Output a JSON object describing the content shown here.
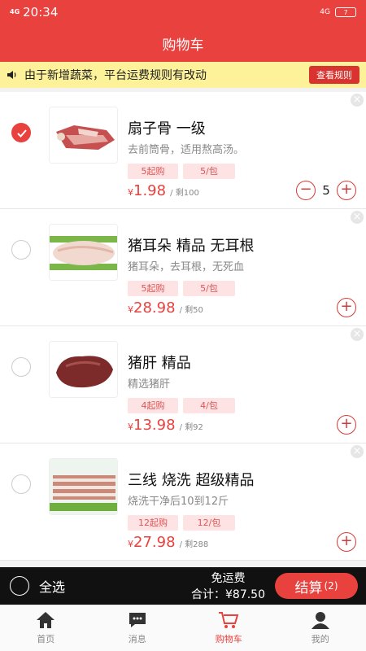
{
  "status_bar": {
    "time": "20:34",
    "signal": "4G",
    "network": "4G",
    "battery": "7"
  },
  "header": {
    "title": "购物车"
  },
  "notice": {
    "text": "由于新增蔬菜，平台运费规则有改动",
    "button": "查看规则"
  },
  "items": [
    {
      "name": "扇子骨 一级",
      "desc": "去前筒骨，适用熬高汤。",
      "min_order": "5起购",
      "pack": "5/包",
      "currency": "¥",
      "price": "1.98",
      "stock": "/ 剩100",
      "qty": "5",
      "checked": true,
      "image": "pork-bone-image"
    },
    {
      "name": "猪耳朵 精品 无耳根",
      "desc": "猪耳朵，去耳根，无死血",
      "min_order": "5起购",
      "pack": "5/包",
      "currency": "¥",
      "price": "28.98",
      "stock": "/ 剩50",
      "checked": false,
      "image": "pig-ear-image"
    },
    {
      "name": "猪肝 精品",
      "desc": "精选猪肝",
      "min_order": "4起购",
      "pack": "4/包",
      "currency": "¥",
      "price": "13.98",
      "stock": "/ 剩92",
      "checked": false,
      "image": "pork-liver-image"
    },
    {
      "name": "三线 烧洗 超级精品",
      "desc": "烧洗干净后10到12斤",
      "min_order": "12起购",
      "pack": "12/包",
      "currency": "¥",
      "price": "27.98",
      "stock": "/ 剩288",
      "checked": false,
      "image": "pork-belly-image"
    }
  ],
  "checkout": {
    "select_all": "全选",
    "free_shipping": "免运费",
    "total": "合计：¥87.50",
    "button": "结算",
    "count": "(2)"
  },
  "tabbar": [
    {
      "label": "首页",
      "icon": "home-icon"
    },
    {
      "label": "消息",
      "icon": "message-icon"
    },
    {
      "label": "购物车",
      "icon": "cart-icon",
      "active": true
    },
    {
      "label": "我的",
      "icon": "user-icon"
    }
  ],
  "colors": {
    "brand": "#e8413e",
    "notice_bg": "#fdf29a",
    "tag_bg": "#fde3e3"
  }
}
